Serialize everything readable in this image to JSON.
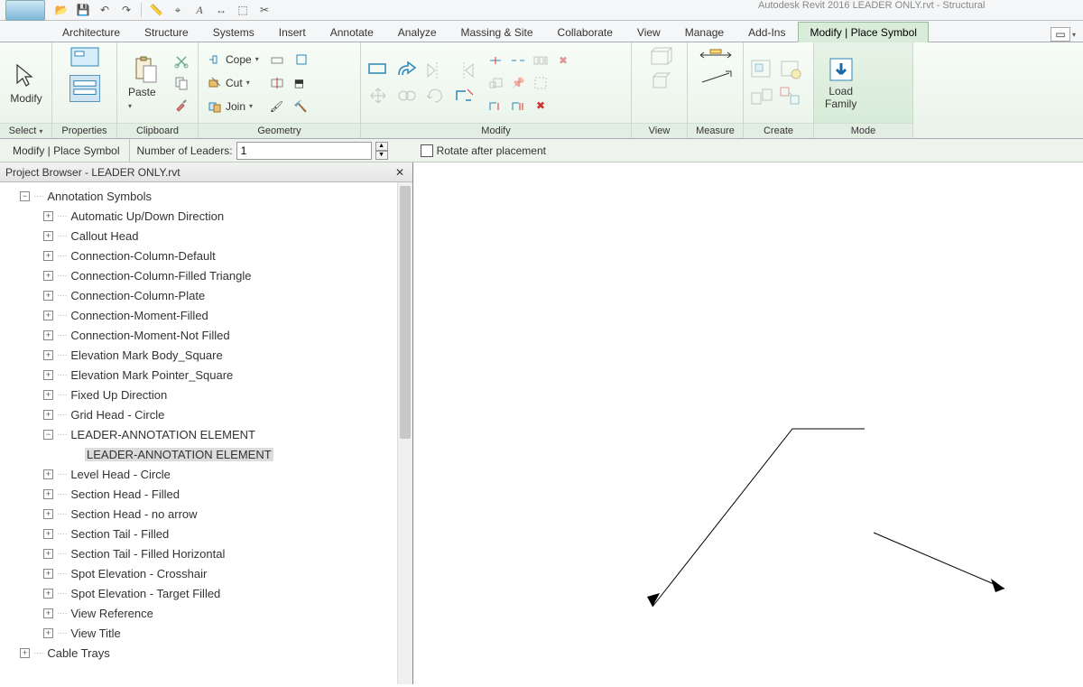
{
  "title_fragment": "Autodesk Revit 2016    LEADER ONLY.rvt - Structural",
  "tabs": [
    "Architecture",
    "Structure",
    "Systems",
    "Insert",
    "Annotate",
    "Analyze",
    "Massing & Site",
    "Collaborate",
    "View",
    "Manage",
    "Add-Ins",
    "Modify | Place Symbol"
  ],
  "active_tab_index": 11,
  "panels": {
    "select": "Select",
    "properties": "Properties",
    "clipboard": "Clipboard",
    "geometry": "Geometry",
    "modify": "Modify",
    "view": "View",
    "measure": "Measure",
    "create": "Create",
    "mode": "Mode"
  },
  "buttons": {
    "modify": "Modify",
    "paste": "Paste",
    "cope": "Cope",
    "cut": "Cut",
    "join": "Join",
    "load_family": "Load\nFamily"
  },
  "options": {
    "context": "Modify | Place Symbol",
    "leaders_label": "Number of Leaders:",
    "leaders_value": "1",
    "rotate_label": "Rotate after placement"
  },
  "browser": {
    "title": "Project Browser - LEADER ONLY.rvt",
    "root": "Annotation Symbols",
    "items": [
      "Automatic Up/Down Direction",
      "Callout Head",
      "Connection-Column-Default",
      "Connection-Column-Filled Triangle",
      "Connection-Column-Plate",
      "Connection-Moment-Filled",
      "Connection-Moment-Not Filled",
      "Elevation Mark Body_Square",
      "Elevation Mark Pointer_Square",
      "Fixed Up Direction",
      "Grid Head - Circle"
    ],
    "expanded_item": "LEADER-ANNOTATION ELEMENT",
    "expanded_child": "LEADER-ANNOTATION ELEMENT",
    "items_after": [
      "Level Head - Circle",
      "Section Head - Filled",
      "Section Head - no arrow",
      "Section Tail - Filled",
      "Section Tail - Filled Horizontal",
      "Spot Elevation - Crosshair",
      "Spot Elevation - Target Filled",
      "View Reference",
      "View Title"
    ],
    "trailing_root": "Cable Trays"
  }
}
